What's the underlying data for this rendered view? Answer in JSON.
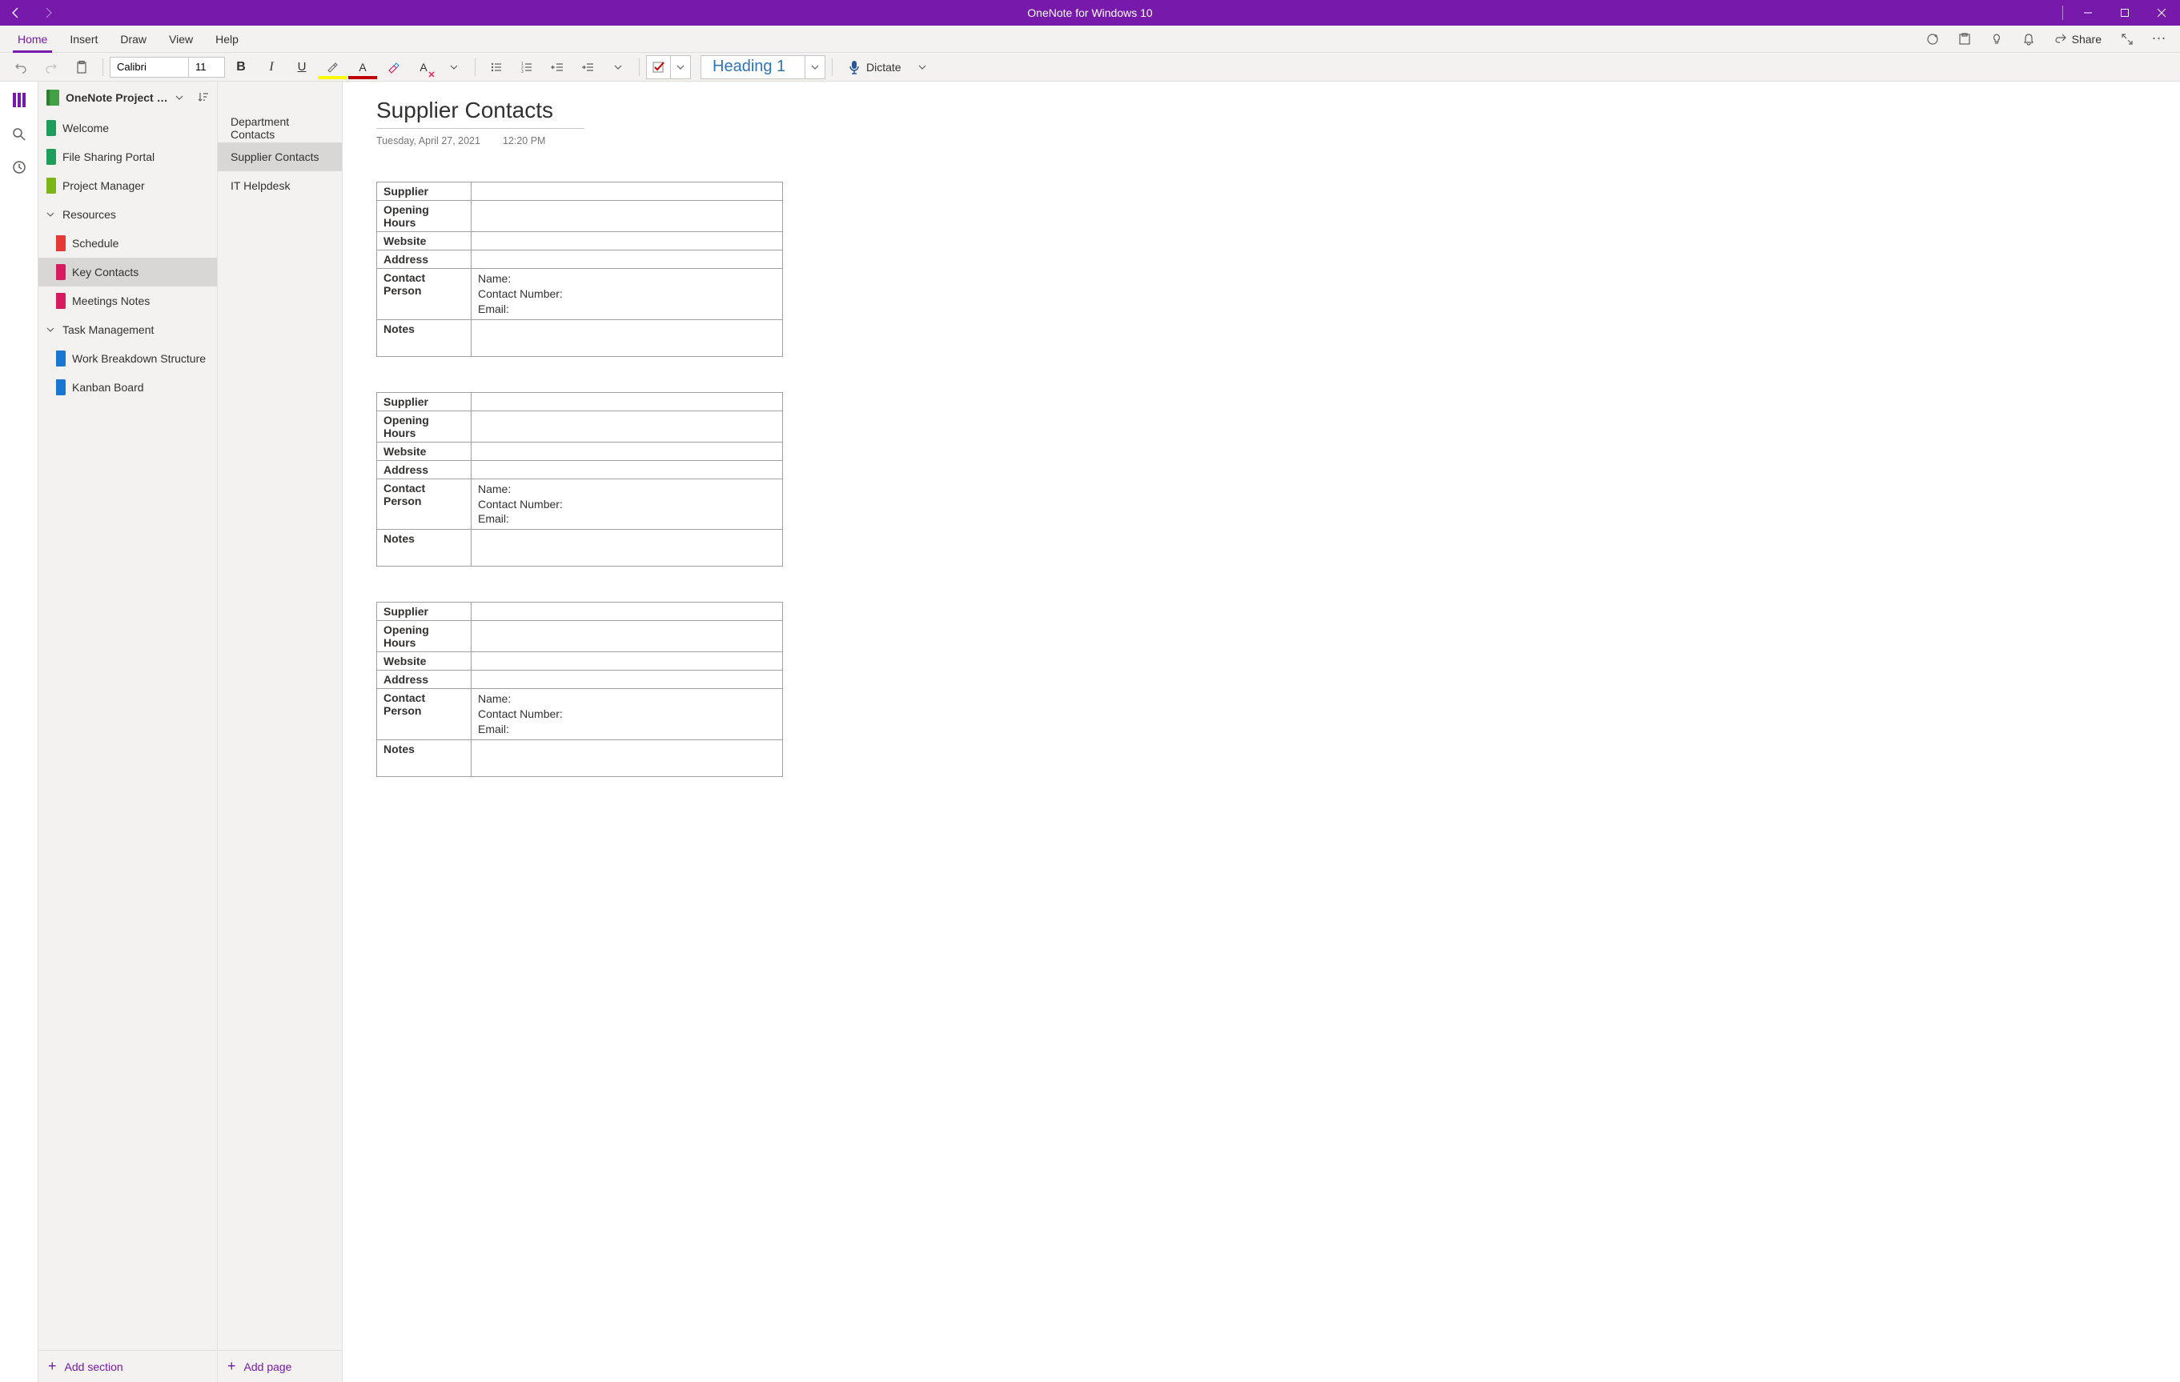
{
  "title_bar": {
    "app_title": "OneNote for Windows 10"
  },
  "ribbon": {
    "tabs": [
      "Home",
      "Insert",
      "Draw",
      "View",
      "Help"
    ],
    "active_tab": 0,
    "share_label": "Share"
  },
  "toolbar": {
    "font_name": "Calibri",
    "font_size": "11",
    "style_name": "Heading 1",
    "dictate_label": "Dictate"
  },
  "notebook": {
    "name": "OneNote Project Management",
    "sections": [
      {
        "label": "Welcome",
        "color": "#1E9E5A",
        "indent": 0
      },
      {
        "label": "File Sharing Portal",
        "color": "#1E9E5A",
        "indent": 0
      },
      {
        "label": "Project Manager",
        "color": "#7CB518",
        "indent": 0
      },
      {
        "label": "Resources",
        "group": true,
        "indent": 0
      },
      {
        "label": "Schedule",
        "color": "#E53935",
        "indent": 1
      },
      {
        "label": "Key Contacts",
        "color": "#D81B60",
        "indent": 1,
        "selected": true
      },
      {
        "label": "Meetings Notes",
        "color": "#D81B60",
        "indent": 1
      },
      {
        "label": "Task Management",
        "group": true,
        "indent": 0
      },
      {
        "label": "Work Breakdown Structure",
        "color": "#1976D2",
        "indent": 1
      },
      {
        "label": "Kanban Board",
        "color": "#1976D2",
        "indent": 1
      }
    ],
    "add_section_label": "Add section"
  },
  "pages": {
    "items": [
      {
        "label": "Department Contacts"
      },
      {
        "label": "Supplier Contacts",
        "selected": true
      },
      {
        "label": "IT Helpdesk"
      }
    ],
    "add_page_label": "Add page"
  },
  "canvas": {
    "page_title": "Supplier Contacts",
    "date": "Tuesday, April 27, 2021",
    "time": "12:20 PM",
    "table_labels": {
      "supplier": "Supplier",
      "opening_hours": "Opening Hours",
      "website": "Website",
      "address": "Address",
      "contact_person": "Contact Person",
      "notes": "Notes",
      "name": "Name:",
      "contact_number": "Contact Number:",
      "email": "Email:"
    }
  }
}
